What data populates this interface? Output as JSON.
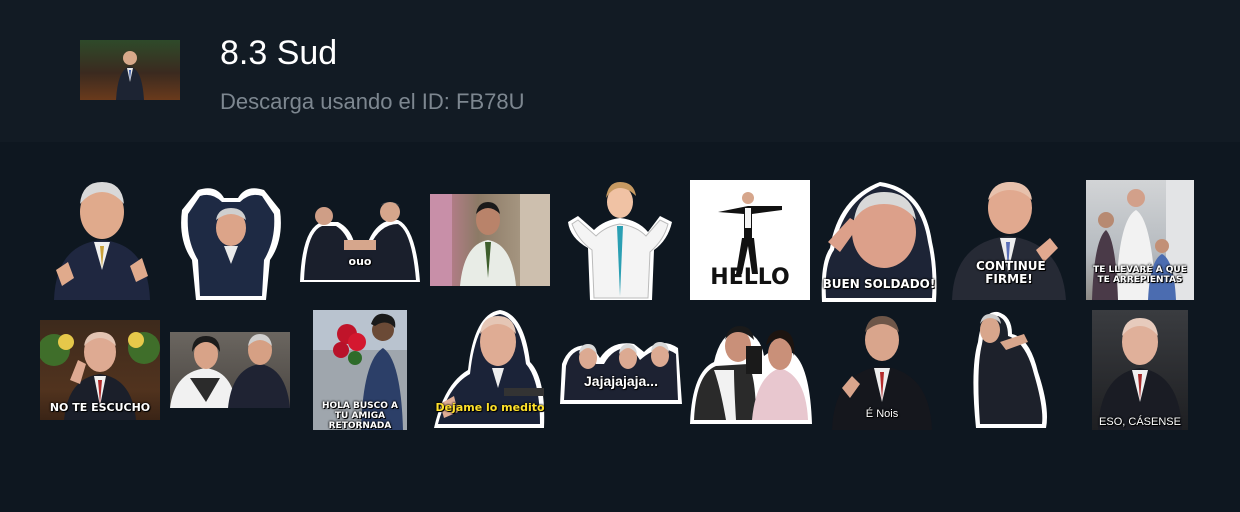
{
  "pack": {
    "title": "8.3 Sud",
    "subtitle": "Descarga usando el ID: FB78U"
  },
  "colors": {
    "background": "#0f1821",
    "header": "#121b24",
    "subtitle_text": "#7d8790",
    "caption_yellow": "#ffe12a"
  },
  "stickers": [
    {
      "caption": ""
    },
    {
      "caption": ""
    },
    {
      "caption": "ouo"
    },
    {
      "caption": ""
    },
    {
      "caption": ""
    },
    {
      "caption": "HELLO"
    },
    {
      "caption": "BUEN SOLDADO!"
    },
    {
      "caption": "CONTINUE FIRME!"
    },
    {
      "caption": "TE LLEVARÉ A QUE TE ARREPIENTAS"
    },
    {
      "caption": "NO TE ESCUCHO"
    },
    {
      "caption": ""
    },
    {
      "caption": "HOLA BUSCO A TU AMIGA RETORNADA"
    },
    {
      "caption": "Dejame lo medito"
    },
    {
      "caption": "Jajajajaja..."
    },
    {
      "caption": ""
    },
    {
      "caption": "É Nois"
    },
    {
      "caption": ""
    },
    {
      "caption": "ESO, CÁSENSE"
    }
  ]
}
